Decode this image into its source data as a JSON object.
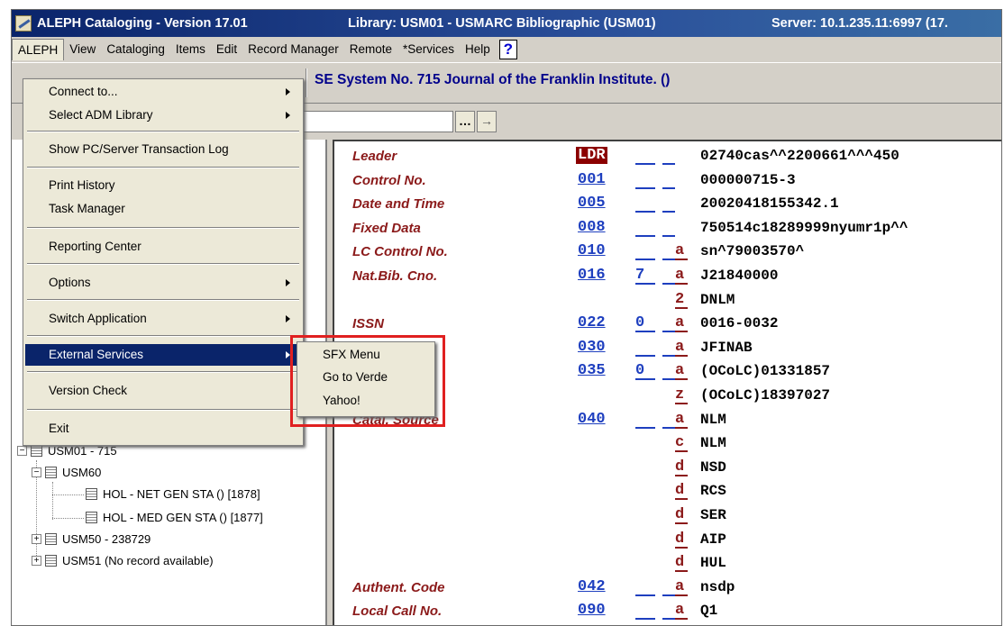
{
  "window": {
    "title_app": "ALEPH Cataloging - Version 17.01",
    "title_library": "Library: USM01 - USMARC Bibliographic (USM01)",
    "title_server": "Server: 10.1.235.11:6997 (17."
  },
  "menubar": {
    "items": [
      "ALEPH",
      "View",
      "Cataloging",
      "Items",
      "Edit",
      "Record Manager",
      "Remote",
      "*Services",
      "Help"
    ],
    "help_icon": "?"
  },
  "toolbar": {
    "record_title": "SE System No. 715 Journal of the Franklin Institute. ()"
  },
  "nav": {
    "more_button": "…",
    "go_button": "→"
  },
  "dropdown": {
    "items": [
      {
        "label": "Connect to...",
        "submenu": true
      },
      {
        "label": "Select ADM Library",
        "submenu": true
      },
      {
        "label": "Show PC/Server Transaction Log",
        "submenu": false
      },
      {
        "label": "Print History",
        "submenu": false
      },
      {
        "label": "Task Manager",
        "submenu": false
      },
      {
        "label": "Reporting Center",
        "submenu": false
      },
      {
        "label": "Options",
        "submenu": true
      },
      {
        "label": "Switch Application",
        "submenu": true
      },
      {
        "label": "External Services",
        "submenu": true
      },
      {
        "label": "Version Check",
        "submenu": false
      },
      {
        "label": "Exit",
        "submenu": false
      }
    ]
  },
  "submenu": {
    "items": [
      "SFX Menu",
      "Go to Verde",
      "Yahoo!"
    ]
  },
  "tree": {
    "nodes": [
      {
        "label": "USM01 - 715"
      },
      {
        "label": "USM60"
      },
      {
        "label": "HOL - NET GEN STA () [1878]"
      },
      {
        "label": "HOL - MED GEN STA () [1877]"
      },
      {
        "label": "USM50 - 238729"
      },
      {
        "label": "USM51 (No record available)"
      }
    ]
  },
  "record": {
    "rows": [
      {
        "label": "Leader",
        "tag": "LDR",
        "ind1": "",
        "ind2": "",
        "sub": "",
        "value": "02740cas^^2200661^^^450"
      },
      {
        "label": "Control No.",
        "tag": "001",
        "ind1": "",
        "ind2": "",
        "sub": "",
        "value": "000000715-3"
      },
      {
        "label": "Date and Time",
        "tag": "005",
        "ind1": "",
        "ind2": "",
        "sub": "",
        "value": "20020418155342.1"
      },
      {
        "label": "Fixed Data",
        "tag": "008",
        "ind1": "",
        "ind2": "",
        "sub": "",
        "value": "750514c18289999nyumr1p^^"
      },
      {
        "label": "LC Control No.",
        "tag": "010",
        "ind1": "",
        "ind2": "",
        "sub": "a",
        "value": "sn^79003570^"
      },
      {
        "label": "Nat.Bib. Cno.",
        "tag": "016",
        "ind1": "7",
        "ind2": "",
        "sub": "a",
        "value": "J21840000"
      },
      {
        "label": "",
        "tag": "",
        "ind1": "",
        "ind2": "",
        "sub": "2",
        "value": "DNLM"
      },
      {
        "label": "ISSN",
        "tag": "022",
        "ind1": "0",
        "ind2": "",
        "sub": "a",
        "value": "0016-0032"
      },
      {
        "label": "",
        "tag": "030",
        "ind1": "",
        "ind2": "",
        "sub": "a",
        "value": "JFINAB"
      },
      {
        "label": "",
        "tag": "035",
        "ind1": "0",
        "ind2": "",
        "sub": "a",
        "value": "(OCoLC)01331857"
      },
      {
        "label": "",
        "tag": "",
        "ind1": "",
        "ind2": "",
        "sub": "z",
        "value": "(OCoLC)18397027"
      },
      {
        "label": "Catal. Source",
        "tag": "040",
        "ind1": "",
        "ind2": "",
        "sub": "a",
        "value": "NLM"
      },
      {
        "label": "",
        "tag": "",
        "ind1": "",
        "ind2": "",
        "sub": "c",
        "value": "NLM"
      },
      {
        "label": "",
        "tag": "",
        "ind1": "",
        "ind2": "",
        "sub": "d",
        "value": "NSD"
      },
      {
        "label": "",
        "tag": "",
        "ind1": "",
        "ind2": "",
        "sub": "d",
        "value": "RCS"
      },
      {
        "label": "",
        "tag": "",
        "ind1": "",
        "ind2": "",
        "sub": "d",
        "value": "SER"
      },
      {
        "label": "",
        "tag": "",
        "ind1": "",
        "ind2": "",
        "sub": "d",
        "value": "AIP"
      },
      {
        "label": "",
        "tag": "",
        "ind1": "",
        "ind2": "",
        "sub": "d",
        "value": "HUL"
      },
      {
        "label": "Authent. Code",
        "tag": "042",
        "ind1": "",
        "ind2": "",
        "sub": "a",
        "value": "nsdp"
      },
      {
        "label": "Local Call No.",
        "tag": "090",
        "ind1": "",
        "ind2": "",
        "sub": "a",
        "value": "Q1"
      }
    ]
  }
}
